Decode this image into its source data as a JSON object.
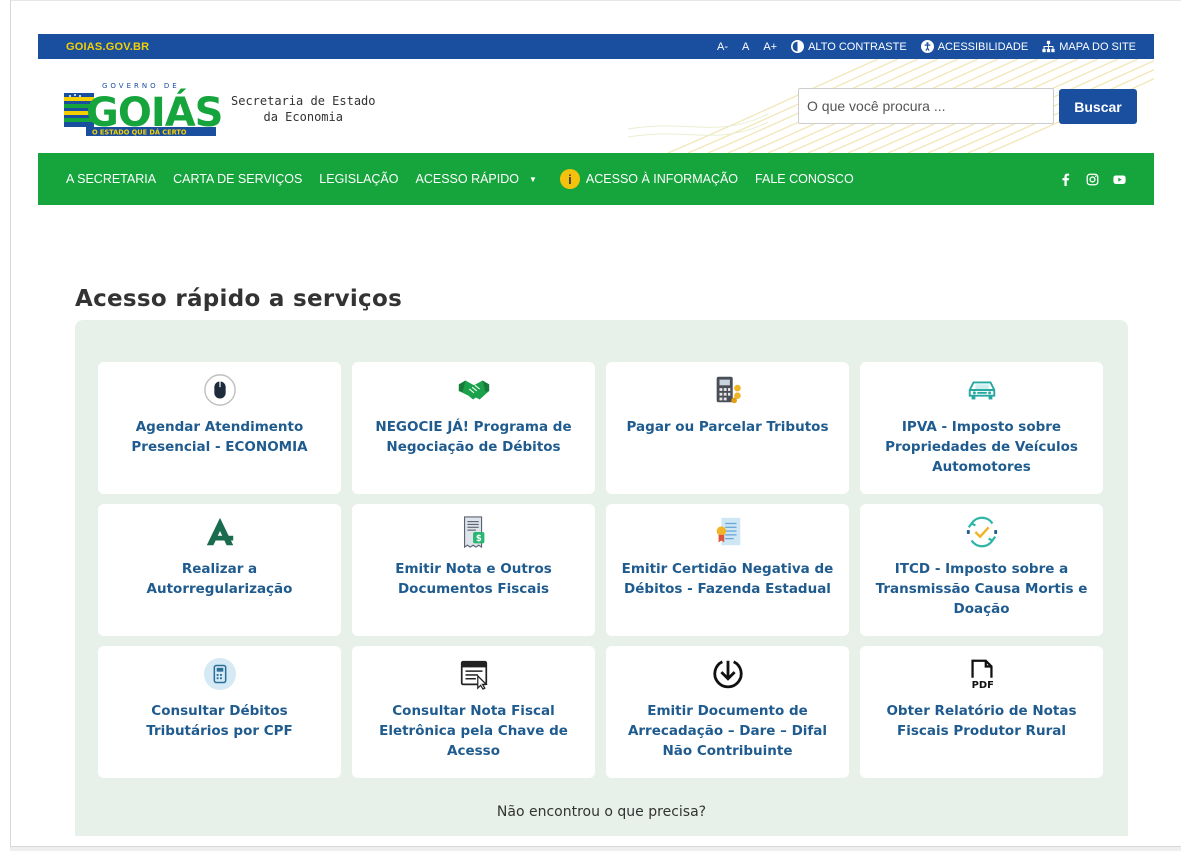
{
  "topbar": {
    "site": "GOIAS.GOV.BR",
    "font_decrease": "A-",
    "font_normal": "A",
    "font_increase": "A+",
    "contrast": "ALTO CONTRASTE",
    "accessibility": "ACESSIBILIDADE",
    "sitemap": "MAPA DO SITE"
  },
  "header": {
    "logo_top": "GOVERNO DE",
    "logo_main": "GOIÁS",
    "logo_sub": "O ESTADO QUE DÁ CERTO",
    "secretaria_line1": "Secretaria de Estado",
    "secretaria_line2": "da Economia",
    "search_placeholder": "O que você procura ...",
    "search_button": "Buscar"
  },
  "nav": {
    "items": [
      {
        "label": "A SECRETARIA"
      },
      {
        "label": "CARTA DE SERVIÇOS"
      },
      {
        "label": "LEGISLAÇÃO"
      },
      {
        "label": "ACESSO RÁPIDO"
      },
      {
        "label": "ACESSO À INFORMAÇÃO"
      },
      {
        "label": "FALE CONOSCO"
      }
    ],
    "caret": "▼",
    "info_glyph": "i"
  },
  "section": {
    "title": "Acesso rápido a serviços",
    "not_found": "Não encontrou o que precisa?"
  },
  "cards": [
    {
      "label": "Agendar Atendimento Presencial - ECONOMIA",
      "icon": "mouse-icon"
    },
    {
      "label": "NEGOCIE JÁ! Programa de Negociação de Débitos",
      "icon": "handshake-icon"
    },
    {
      "label": "Pagar ou Parcelar Tributos",
      "icon": "calculator-coins-icon"
    },
    {
      "label": "IPVA - Imposto sobre Propriedades de Veículos Automotores",
      "icon": "car-icon"
    },
    {
      "label": "Realizar a Autorregularização",
      "icon": "autorregularizacao-icon"
    },
    {
      "label": "Emitir Nota e Outros Documentos Fiscais",
      "icon": "receipt-icon"
    },
    {
      "label": "Emitir Certidão Negativa de Débitos - Fazenda Estadual",
      "icon": "certificate-icon"
    },
    {
      "label": "ITCD - Imposto sobre a Transmissão Causa Mortis e Doação",
      "icon": "transfer-check-icon"
    },
    {
      "label": "Consultar Débitos Tributários por CPF",
      "icon": "calculator-circle-icon"
    },
    {
      "label": "Consultar Nota Fiscal Eletrônica pela Chave de Acesso",
      "icon": "browser-click-icon"
    },
    {
      "label": "Emitir Documento de Arrecadação – Dare – Difal Não Contribuinte",
      "icon": "download-circle-icon"
    },
    {
      "label": "Obter Relatório de Notas Fiscais Produtor Rural",
      "icon": "pdf-file-icon",
      "icon_text": "PDF"
    }
  ],
  "colors": {
    "topbar": "#1a4fa0",
    "nav": "#16a53d",
    "panel": "#e7f1e9",
    "card_text": "#1f5b8e",
    "accent_yellow": "#f5d000"
  }
}
